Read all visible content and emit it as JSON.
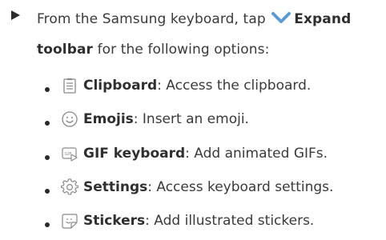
{
  "intro": {
    "text_before": "From the Samsung keyboard, tap",
    "expand_label": "Expand",
    "toolbar_label": "toolbar",
    "text_after": "for the following options:",
    "icon": "chevron-down-icon",
    "chevron_color": "#5b9bd5"
  },
  "items": [
    {
      "label": "Clipboard",
      "desc": ": Access the clipboard.",
      "icon": "clipboard-icon"
    },
    {
      "label": "Emojis",
      "desc": ": Insert an emoji.",
      "icon": "emoji-icon"
    },
    {
      "label": "GIF keyboard",
      "desc": ": Add animated GIFs.",
      "icon": "gif-icon"
    },
    {
      "label": "Settings",
      "desc": ": Access keyboard settings.",
      "icon": "gear-icon"
    },
    {
      "label": "Stickers",
      "desc": ": Add illustrated stickers.",
      "icon": "sticker-icon"
    }
  ]
}
